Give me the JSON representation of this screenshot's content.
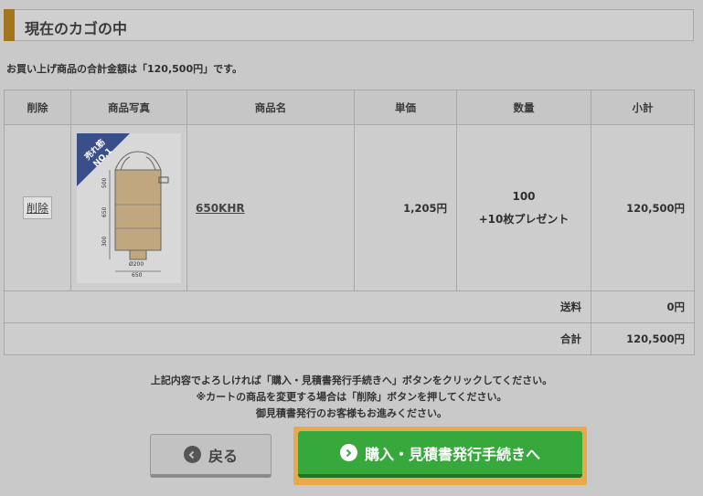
{
  "header": {
    "title": "現在のカゴの中"
  },
  "summary": {
    "text": "お買い上げ商品の合計金額は「120,500円」です。"
  },
  "table": {
    "headers": [
      "削除",
      "商品写真",
      "商品名",
      "単価",
      "数量",
      "小計"
    ],
    "item": {
      "delete_label": "削除",
      "badge_line1": "売れ筋",
      "badge_line2": "NO.1",
      "dims": {
        "h1": "500",
        "h2": "650",
        "h3": "300",
        "w1": "Ø200",
        "w2": "650"
      },
      "product_name": "650KHR",
      "unit_price": "1,205円",
      "quantity": "100",
      "bonus": "+10枚プレゼント",
      "subtotal": "120,500円"
    },
    "shipping": {
      "label": "送料",
      "value": "0円"
    },
    "total": {
      "label": "合計",
      "value": "120,500円"
    }
  },
  "instructions": {
    "line1": "上記内容でよろしければ「購入・見積書発行手続きへ」ボタンをクリックしてください。",
    "line2": "※カートの商品を変更する場合は「削除」ボタンを押してください。",
    "line3": "御見積書発行のお客様もお進みください。"
  },
  "buttons": {
    "back": "戻る",
    "proceed": "購入・見積書発行手続きへ"
  },
  "colors": {
    "accent": "#a3751f",
    "proceed": "#36a83c",
    "frame": "#e9a94a"
  },
  "icons": {
    "back": "chevron-left-circle-icon",
    "proceed": "chevron-right-circle-icon"
  }
}
